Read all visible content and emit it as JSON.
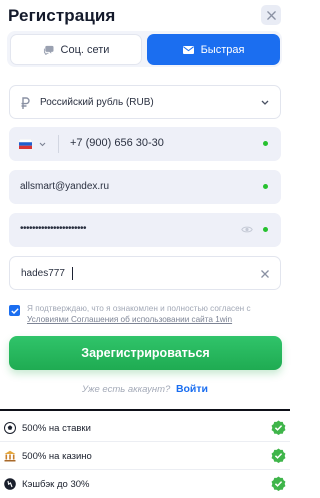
{
  "header": {
    "title": "Регистрация"
  },
  "tabs": [
    {
      "label": "Соц. сети",
      "icon": "chat-bubble-icon",
      "active": false
    },
    {
      "label": "Быстрая",
      "icon": "envelope-icon",
      "active": true
    }
  ],
  "form": {
    "currency": {
      "value": "Российский рубль (RUB)",
      "icon": "ruble-icon"
    },
    "phone": {
      "country_flag": "russia-flag",
      "value": "+7 (900) 656 30-30"
    },
    "email": {
      "value": "allsmart@yandex.ru"
    },
    "password": {
      "value": "••••••••••••••••••••••"
    },
    "promo": {
      "value": "hades777"
    }
  },
  "consent": {
    "text": "Я подтверждаю, что я ознакомлен и полностью согласен с ",
    "link": "Условиями Соглашения об использовании сайта 1win",
    "checked": true
  },
  "register_button": {
    "label": "Зарегистрироваться"
  },
  "login": {
    "question": "Уже есть аккаунт?",
    "link": "Войти"
  },
  "bonuses": [
    {
      "icon": "soccer-ball-icon",
      "label": "500% на ставки"
    },
    {
      "icon": "casino-icon",
      "label": "500% на казино"
    },
    {
      "icon": "cashback-icon",
      "label": "Кэшбэк до 30%"
    }
  ],
  "colors": {
    "accent": "#1b6ef0",
    "success": "#26c12f",
    "button_green": "#2bbb5f"
  }
}
